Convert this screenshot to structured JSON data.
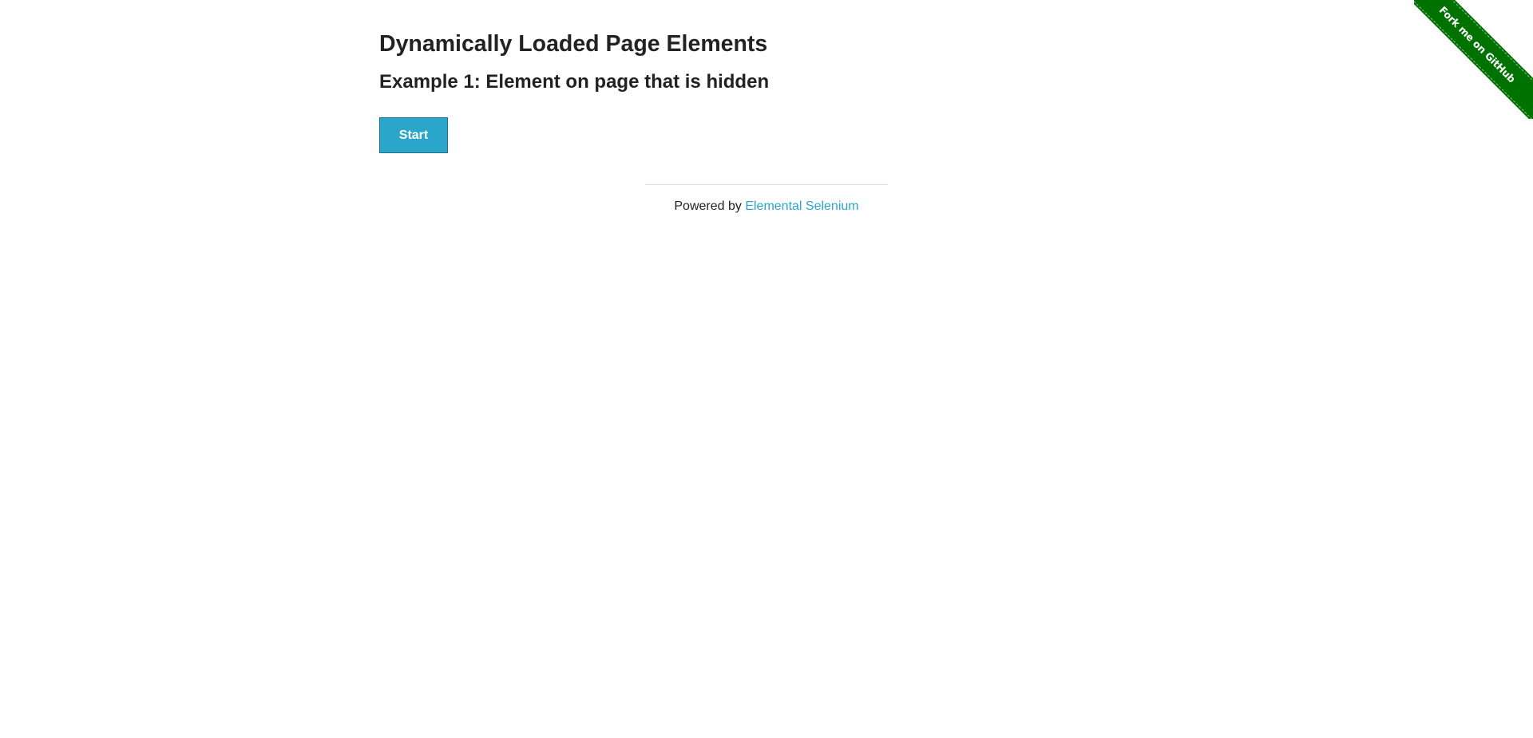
{
  "header": {
    "title": "Dynamically Loaded Page Elements",
    "subtitle": "Example 1: Element on page that is hidden"
  },
  "actions": {
    "start_label": "Start"
  },
  "footer": {
    "prefix": "Powered by",
    "link_text": "Elemental Selenium"
  },
  "ribbon": {
    "text": "Fork me on GitHub",
    "color": "#007200"
  },
  "colors": {
    "accent": "#2ba6cb",
    "text": "#222222"
  }
}
